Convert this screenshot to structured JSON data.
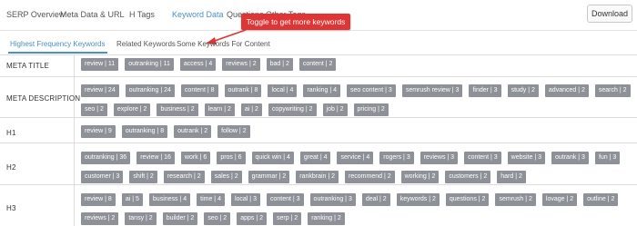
{
  "topnav": {
    "tabs": [
      "SERP Overview",
      "Meta Data & URL",
      "H Tags",
      "Keyword Data",
      "Questions",
      "Other Tags"
    ],
    "active_tab": "Keyword Data",
    "download_label": "Download"
  },
  "callout": {
    "text": "Toggle to get more keywords",
    "color": "#e03535"
  },
  "subtabs": {
    "items": [
      "Highest Frequency Keywords",
      "Related Keywords",
      "Some Keywords For Content"
    ],
    "active": "Highest Frequency Keywords",
    "accent": "#4a90c9"
  },
  "rows": [
    {
      "label": "META TITLE",
      "chips": [
        "review | 11",
        "outranking | 11",
        "access | 4",
        "reviews | 2",
        "bad | 2",
        "content | 2"
      ]
    },
    {
      "label": "META DESCRIPTION",
      "chips": [
        "review | 24",
        "outranking | 24",
        "content | 8",
        "outrank | 8",
        "local | 4",
        "ranking | 4",
        "seo content | 3",
        "semrush review | 3",
        "finder | 3",
        "study | 2",
        "advanced | 2",
        "search | 2",
        "seo | 2",
        "explore | 2",
        "business | 2",
        "learn | 2",
        "ai | 2",
        "copywriting | 2",
        "job | 2",
        "pricing | 2"
      ]
    },
    {
      "label": "H1",
      "chips": [
        "review | 9",
        "outranking | 8",
        "outrank | 2",
        "follow | 2"
      ]
    },
    {
      "label": "H2",
      "chips": [
        "outranking | 36",
        "review | 16",
        "work | 6",
        "pros | 6",
        "quick win | 4",
        "great | 4",
        "service | 4",
        "rogers | 3",
        "reviews | 3",
        "content | 3",
        "website | 3",
        "outrank | 3",
        "fun | 3",
        "customer | 3",
        "shift | 2",
        "research | 2",
        "sales | 2",
        "grammar | 2",
        "rankbrain | 2",
        "recommend | 2",
        "working | 2",
        "customers | 2",
        "hard | 2"
      ]
    },
    {
      "label": "H3",
      "chips": [
        "review | 8",
        "ai | 5",
        "business | 4",
        "time | 4",
        "local | 3",
        "content | 3",
        "outranking | 3",
        "deal | 2",
        "keywords | 2",
        "questions | 2",
        "semrush | 2",
        "lovage | 2",
        "outline | 2",
        "reviews | 2",
        "tansy | 2",
        "builder | 2",
        "seo | 2",
        "apps | 2",
        "serp | 2",
        "ranking | 2"
      ]
    }
  ]
}
